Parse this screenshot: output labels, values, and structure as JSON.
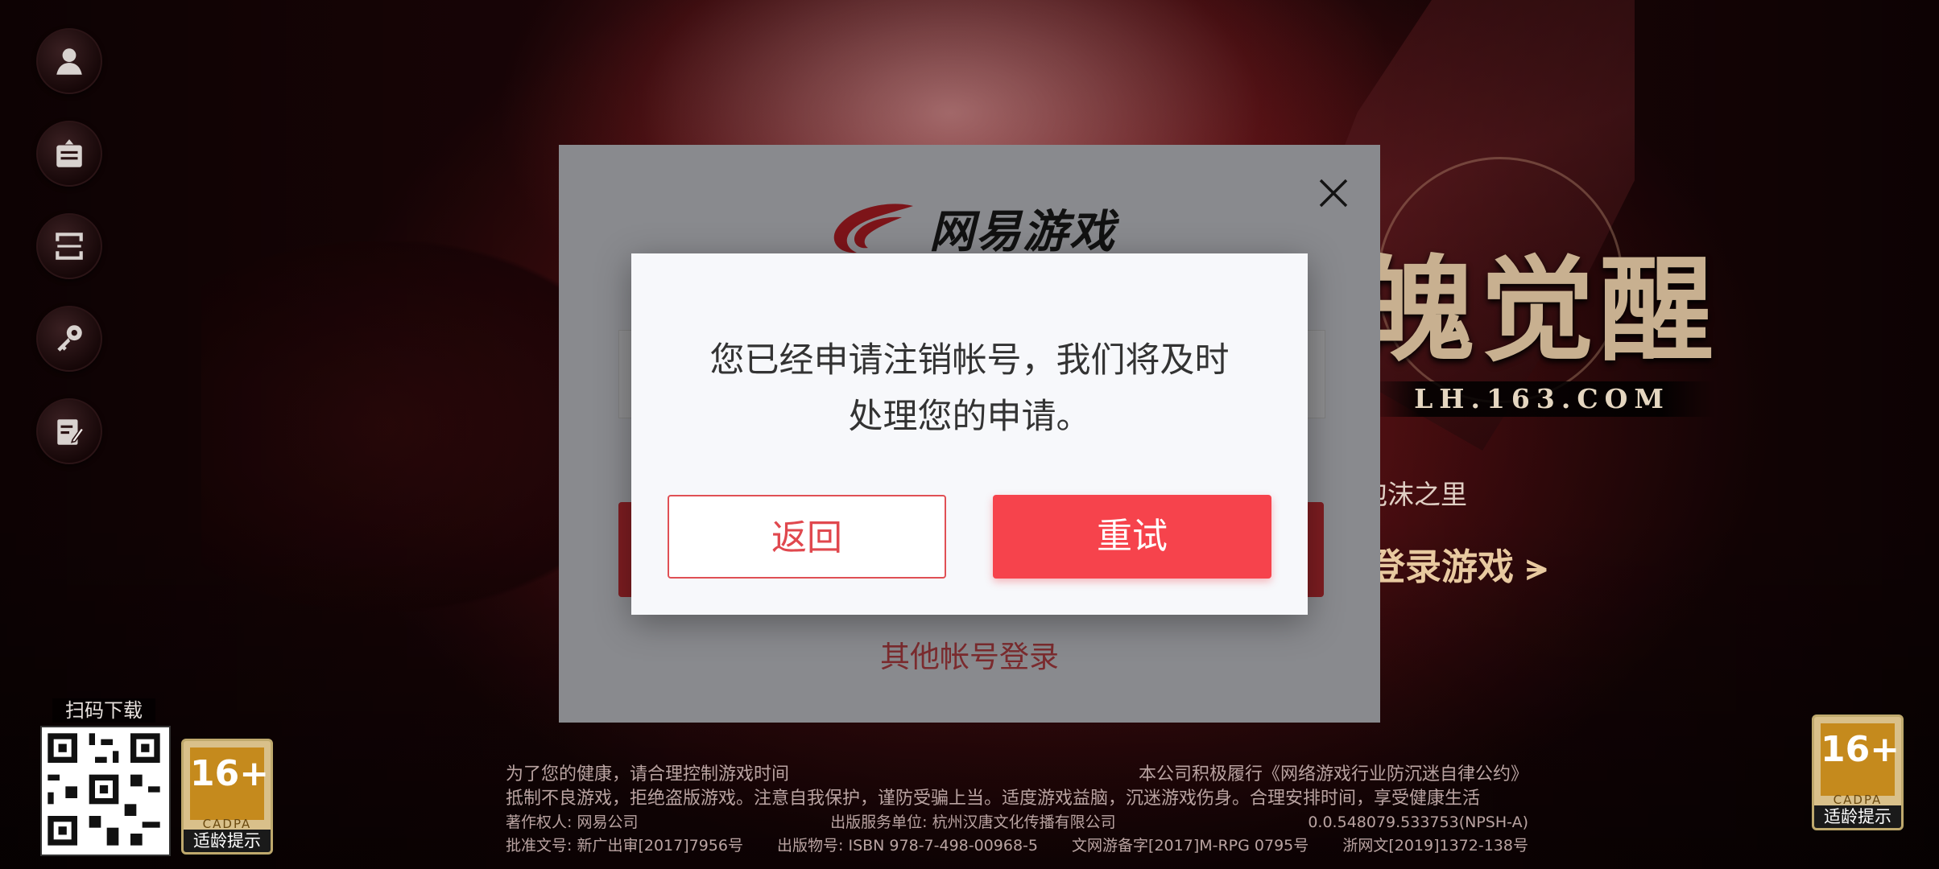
{
  "background": {
    "game_title": "魄觉醒",
    "game_url": "LH.163.COM",
    "account_hint": "泡沫之里",
    "login_game_label": "登录游戏 ⪫"
  },
  "sidebar": {
    "items": [
      {
        "icon": "user-icon"
      },
      {
        "icon": "announcement-icon"
      },
      {
        "icon": "scan-icon"
      },
      {
        "icon": "key-icon"
      },
      {
        "icon": "notes-icon"
      }
    ]
  },
  "qr": {
    "label": "扫码下载"
  },
  "age_rating": {
    "value": "16+",
    "org": "CADPA",
    "tip": "适龄提示"
  },
  "footer": {
    "health_notice": "为了您的健康，请合理控制游戏时间",
    "convention": "本公司积极履行《网络游戏行业防沉迷自律公约》",
    "advice": "抵制不良游戏，拒绝盗版游戏。注意自我保护，谨防受骗上当。适度游戏益脑，沉迷游戏伤身。合理安排时间，享受健康生活",
    "copyright": "著作权人: 网易公司",
    "publisher": "出版服务单位: 杭州汉唐文化传播有限公司",
    "version": "0.0.548079.533753(NPSH-A)",
    "approval": "批准文号: 新广出审[2017]7956号",
    "isbn": "出版物号: ISBN 978-7-498-00968-5",
    "culture_record": "文网游备字[2017]M-RPG 0795号",
    "zhejiang_record": "浙网文[2019]1372-138号"
  },
  "login_panel": {
    "logo_text": "网易游戏",
    "other_account_label": "其他帐号登录"
  },
  "dialog": {
    "message_line1": "您已经申请注销帐号，我们将及时",
    "message_line2": "处理您的申请。",
    "back_label": "返回",
    "retry_label": "重试"
  },
  "colors": {
    "accent": "#f6434c",
    "accent_text": "#e0484e",
    "dialog_bg": "#f7f8fb"
  }
}
